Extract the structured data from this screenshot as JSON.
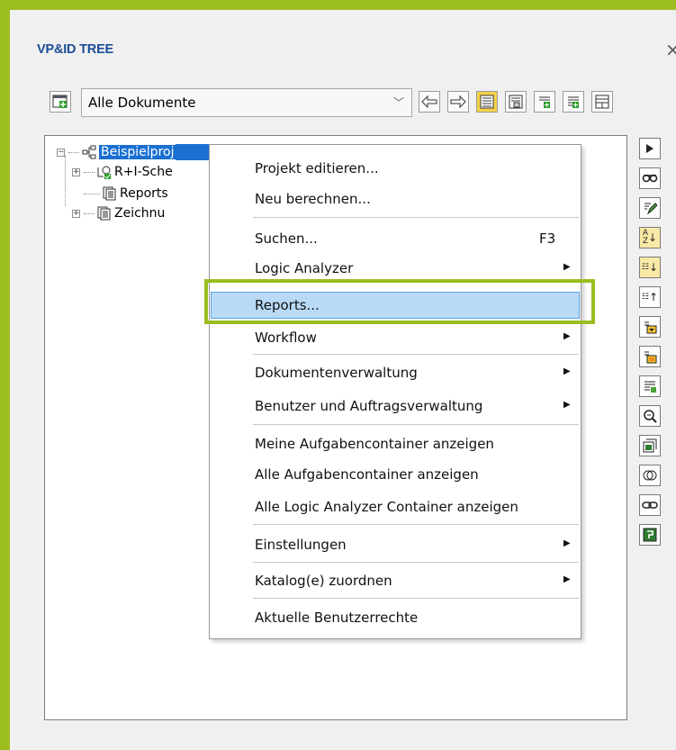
{
  "panel": {
    "title": "VP&ID TREE",
    "close_label": "×",
    "accent_color": "#9cbd20"
  },
  "toolbar": {
    "filter_value": "Alle Dokumente",
    "icons": [
      "new-window-icon",
      "back-arrow-icon",
      "forward-arrow-icon",
      "list-view-icon",
      "list-detail-icon",
      "add-item-icon",
      "add-list-icon",
      "grid-icon"
    ]
  },
  "tree": {
    "root_label": "Beispielproj",
    "nodes": [
      {
        "label": "R+I-Sche",
        "icon": "pid-diagram-icon"
      },
      {
        "label": "Reports",
        "icon": "documents-icon"
      },
      {
        "label": "Zeichnu",
        "icon": "documents-icon"
      }
    ],
    "selection_color": "#1a6fd1"
  },
  "context_menu": {
    "items": [
      {
        "label": "Projekt editieren..."
      },
      {
        "label": "Neu berechnen..."
      },
      {
        "label": "Suchen...",
        "shortcut": "F3"
      },
      {
        "label": "Logic Analyzer",
        "submenu": true
      },
      {
        "label": "Reports...",
        "hovered": true
      },
      {
        "label": "Workflow",
        "submenu": true
      },
      {
        "label": "Dokumentenverwaltung",
        "submenu": true
      },
      {
        "label": "Benutzer und Auftragsverwaltung",
        "submenu": true
      },
      {
        "label": "Meine Aufgabencontainer anzeigen"
      },
      {
        "label": "Alle Aufgabencontainer anzeigen"
      },
      {
        "label": "Alle Logic Analyzer Container anzeigen"
      },
      {
        "label": "Einstellungen",
        "submenu": true
      },
      {
        "label": "Katalog(e) zuordnen",
        "submenu": true
      },
      {
        "label": "Aktuelle Benutzerrechte"
      }
    ],
    "hover_color": "#b9daf6"
  },
  "side_toolbar": {
    "icons": [
      "play-icon",
      "binoculars-icon",
      "edit-icon",
      "sort-az-icon",
      "sort-down-icon",
      "sort-up-icon",
      "filter-list-icon",
      "filter-list-alt-icon",
      "list-add-icon",
      "zoom-icon",
      "export-icon",
      "compare-icon",
      "link-icon",
      "report-icon"
    ]
  }
}
